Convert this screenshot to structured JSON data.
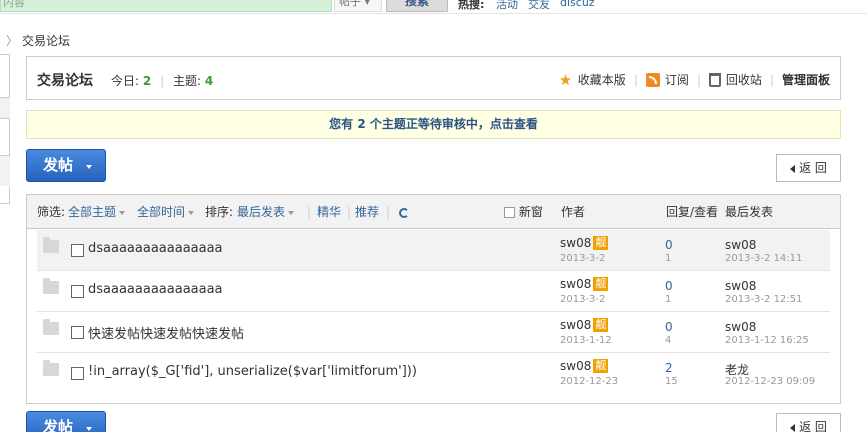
{
  "search": {
    "input_value": "内容",
    "select_value": "帖子",
    "button_label": "搜索",
    "hot_label": "热搜:",
    "hot_items": [
      "活动",
      "交友",
      "discuz"
    ]
  },
  "breadcrumb": {
    "sep": "〉",
    "current": "交易论坛"
  },
  "forum": {
    "title": "交易论坛",
    "today_label": "今日:",
    "today_value": "2",
    "topics_label": "主题:",
    "topics_value": "4",
    "actions": {
      "favorite": "收藏本版",
      "subscribe": "订阅",
      "recycle": "回收站",
      "admin": "管理面板"
    }
  },
  "notice": "您有 2 个主题正等待审核中，点击查看",
  "buttons": {
    "post": "发帖",
    "back": "返 回"
  },
  "filter": {
    "filter_label": "筛选:",
    "all_topics": "全部主题",
    "all_time": "全部时间",
    "sort_label": "排序:",
    "sort_value": "最后发表",
    "digest": "精华",
    "recommend": "推荐",
    "new_window": "新窗",
    "col_author": "作者",
    "col_replies": "回复/查看",
    "col_last": "最后发表"
  },
  "threads": [
    {
      "title": "dsaaaaaaaaaaaaaaa",
      "author": "sw08",
      "badge": "靓",
      "date": "2013-3-2",
      "replies": "0",
      "views": "1",
      "last_poster": "sw08",
      "last_date": "2013-3-2 14:11"
    },
    {
      "title": "dsaaaaaaaaaaaaaaa",
      "author": "sw08",
      "badge": "靓",
      "date": "2013-3-2",
      "replies": "0",
      "views": "1",
      "last_poster": "sw08",
      "last_date": "2013-3-2 12:51"
    },
    {
      "title": "快速发帖快速发帖快速发帖",
      "author": "sw08",
      "badge": "靓",
      "date": "2013-1-12",
      "replies": "0",
      "views": "4",
      "last_poster": "sw08",
      "last_date": "2013-1-12 16:25"
    },
    {
      "title": "!in_array($_G['fid'], unserialize($var['limitforum']))",
      "author": "sw08",
      "badge": "靓",
      "date": "2012-12-23",
      "replies": "2",
      "views": "15",
      "last_poster": "老龙",
      "last_date": "2012-12-23 09:09"
    }
  ]
}
